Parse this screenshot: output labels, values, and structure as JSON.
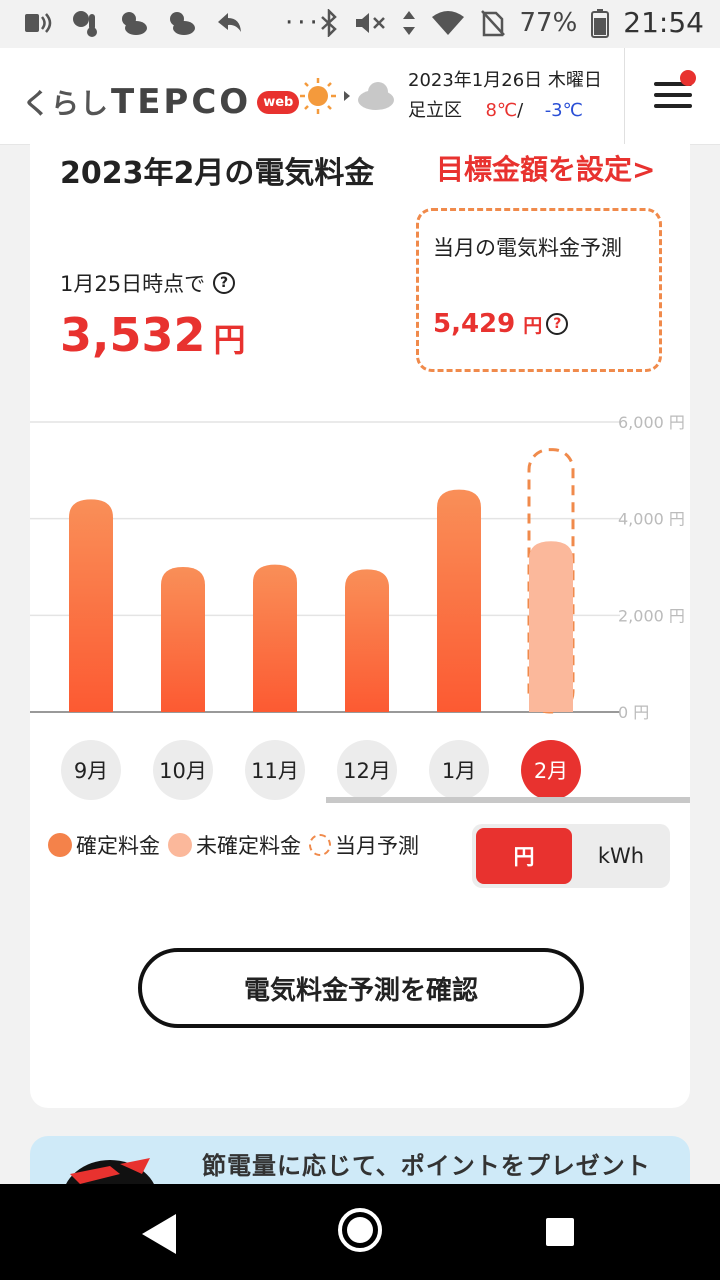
{
  "status_bar": {
    "battery": "77%",
    "time": "21:54",
    "dots": "···"
  },
  "header": {
    "logo_kurashi": "くらし",
    "logo_tepco": "TEPCO",
    "logo_web": "web",
    "date": "2023年1月26日  木曜日",
    "area": "足立区",
    "temp_high": "8℃",
    "temp_sep": "/",
    "temp_low": "-3℃"
  },
  "card": {
    "title": "2023年2月の電気料金",
    "target_link": "目標金額を設定>",
    "as_of": "1月25日時点で",
    "amount": "3,532",
    "amount_unit": "円",
    "forecast_label": "当月の電気料金予測",
    "forecast_amount": "5,429",
    "forecast_unit": "円"
  },
  "chart_data": {
    "type": "bar",
    "categories": [
      "9月",
      "10月",
      "11月",
      "12月",
      "1月",
      "2月"
    ],
    "series": [
      {
        "name": "確定料金",
        "values": [
          4400,
          3000,
          3050,
          2950,
          4600,
          null
        ]
      },
      {
        "name": "未確定料金",
        "values": [
          null,
          null,
          null,
          null,
          null,
          3532
        ]
      },
      {
        "name": "当月予測",
        "values": [
          null,
          null,
          null,
          null,
          null,
          5429
        ]
      }
    ],
    "yticks": [
      "6,000 円",
      "4,000 円",
      "2,000 円",
      "0 円"
    ],
    "ylim": [
      0,
      6000
    ],
    "active_category": "2月",
    "colors": {
      "confirmed": "#f4824a",
      "unconfirmed": "#fbb89b",
      "forecast": "#f08a4b"
    }
  },
  "legend": {
    "confirmed": "確定料金",
    "unconfirmed": "未確定料金",
    "forecast": "当月予測"
  },
  "unit_toggle": {
    "yen": "円",
    "kwh": "kWh",
    "selected": "円"
  },
  "cta": {
    "label": "電気料金予測を確認"
  },
  "banner": {
    "text": "節電量に応じて、ポイントをプレゼント"
  },
  "colors": {
    "accent": "#e8322f",
    "bar": "#f4824a",
    "bar_light": "#fbb89b"
  }
}
